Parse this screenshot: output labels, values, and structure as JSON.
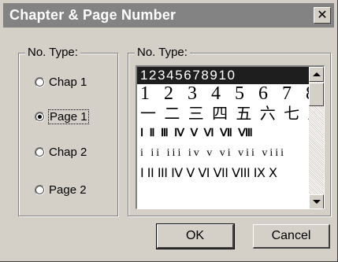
{
  "window": {
    "title": "Chapter & Page Number",
    "close_glyph": "✕"
  },
  "left_group": {
    "label": "No. Type:",
    "options": [
      {
        "label": "Chap 1",
        "checked": false
      },
      {
        "label": "Page 1",
        "checked": true,
        "focused": true
      },
      {
        "label": "Chap 2",
        "checked": false
      },
      {
        "label": "Page 2",
        "checked": false
      }
    ]
  },
  "right_group": {
    "label": "No. Type:",
    "list_items": [
      "12345678910",
      "1 2 3 4 5 6 7 8",
      "一 二 三 四 五 六 七 八",
      "Ⅰ Ⅱ Ⅲ Ⅳ Ⅴ Ⅵ Ⅶ Ⅷ",
      "i ii iii iv v vi vii viii",
      "I II III IV V VI VII VIII IX X"
    ],
    "selected_index": 0
  },
  "buttons": {
    "ok_label": "OK",
    "cancel_label": "Cancel"
  },
  "colors": {
    "titlebar": "#838383",
    "face": "#d4d0c8",
    "selection": "#1e1e1e"
  }
}
